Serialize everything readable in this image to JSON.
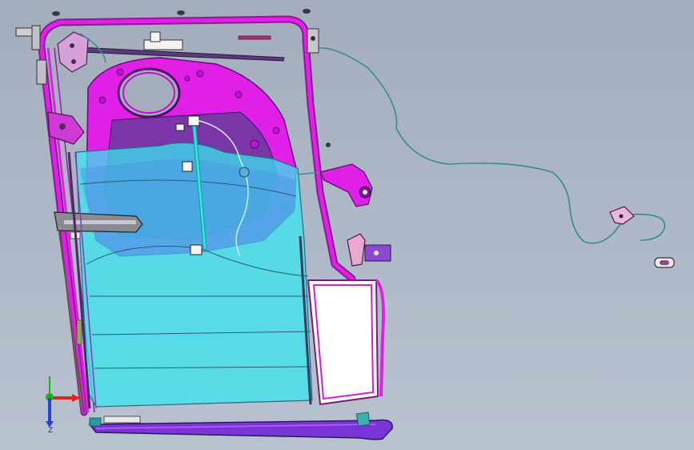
{
  "viewport": {
    "background_top": "#a3adbc",
    "background_bottom": "#b9c2cf"
  },
  "colors": {
    "frame_magenta": "#e020e6",
    "frame_outline": "#8a1a95",
    "glass_cyan": "#38e6ef",
    "glass_blue": "#4a9ae6",
    "glass_outline": "#2a6a8a",
    "inner_panel_purple": "#7a35a8",
    "rail_outline": "#4a2a6a",
    "cable_teal": "#2f8f93",
    "parts_gray": "#7a7f88"
  },
  "triad": {
    "x_axis_color": "#e02020",
    "y_axis_color": "#1fae1f",
    "z_axis_color": "#2a3fd8",
    "z_label": "Z"
  },
  "icons": {
    "triad": "coordinate-triad-icon"
  }
}
